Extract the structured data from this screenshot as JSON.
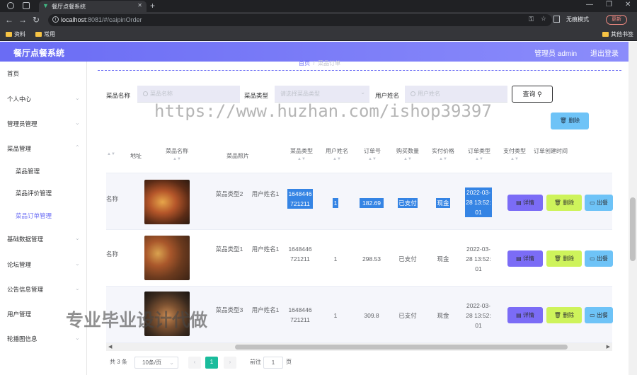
{
  "browser": {
    "tab_title": "餐厅点餐系统",
    "url_host": "localhost",
    "url_rest": ":8081/#/caipinOrder",
    "incognito": "无痕模式",
    "update": "更新",
    "bookmarks": [
      "资料",
      "常用"
    ],
    "other_bookmarks": "其他书签"
  },
  "header": {
    "brand": "餐厅点餐系统",
    "user": "管理员 admin",
    "logout": "退出登录"
  },
  "sidebar": {
    "items": [
      {
        "label": "首页",
        "arrow": false
      },
      {
        "label": "个人中心",
        "arrow": true
      },
      {
        "label": "管理员管理",
        "arrow": true
      },
      {
        "label": "菜品管理",
        "arrow": true
      },
      {
        "label": "菜品管理",
        "sub": true
      },
      {
        "label": "菜品评价管理",
        "sub": true
      },
      {
        "label": "菜品订单管理",
        "sub": true,
        "active": true
      },
      {
        "label": "基础数据管理",
        "arrow": true
      },
      {
        "label": "论坛管理",
        "arrow": true
      },
      {
        "label": "公告信息管理",
        "arrow": true
      },
      {
        "label": "用户管理",
        "arrow": true
      },
      {
        "label": "轮播图信息",
        "arrow": true
      }
    ]
  },
  "breadcrumb": {
    "home": "首页",
    "current": "菜品订单"
  },
  "search": {
    "dish_name_label": "菜品名称",
    "dish_name_placeholder": "菜品名称",
    "dish_type_label": "菜品类型",
    "dish_type_placeholder": "请选择菜品类型",
    "user_name_label": "用户姓名",
    "user_name_placeholder": "用户姓名",
    "query": "查询"
  },
  "delete_button": "删除",
  "watermark": "https://www.huzhan.com/ishop39397",
  "watermark2": "专业毕业设计代做",
  "table": {
    "headers": [
      "",
      "地址",
      "菜品名称",
      "菜品照片",
      "菜品类型",
      "用户姓名",
      "订单号",
      "购买数量",
      "实付价格",
      "订单类型",
      "支付类型",
      "订单创建时间"
    ],
    "rows": [
      {
        "name": "名称",
        "type": "菜品类型2",
        "user": "用户姓名1",
        "order_no": "1648446721211",
        "qty": "1",
        "price": "182.69",
        "order_type": "已支付",
        "pay_type": "现金",
        "time": "2022-03-28 13:52:01"
      },
      {
        "name": "名称",
        "type": "菜品类型1",
        "user": "用户姓名1",
        "order_no": "1648446721211",
        "qty": "1",
        "price": "298.53",
        "order_type": "已支付",
        "pay_type": "现金",
        "time": "2022-03-28 13:52:01"
      },
      {
        "name": "",
        "type": "菜品类型3",
        "user": "用户姓名1",
        "order_no": "1648446721211",
        "qty": "1",
        "price": "309.8",
        "order_type": "已支付",
        "pay_type": "现金",
        "time": "2022-03-28 13:52:01"
      }
    ],
    "actions": {
      "detail": "详情",
      "delete": "删除",
      "ship": "出餐"
    }
  },
  "pagination": {
    "total": "共 3 条",
    "page_size": "10条/页",
    "current": "1",
    "goto": "前往",
    "goto_value": "1",
    "page_unit": "页"
  }
}
